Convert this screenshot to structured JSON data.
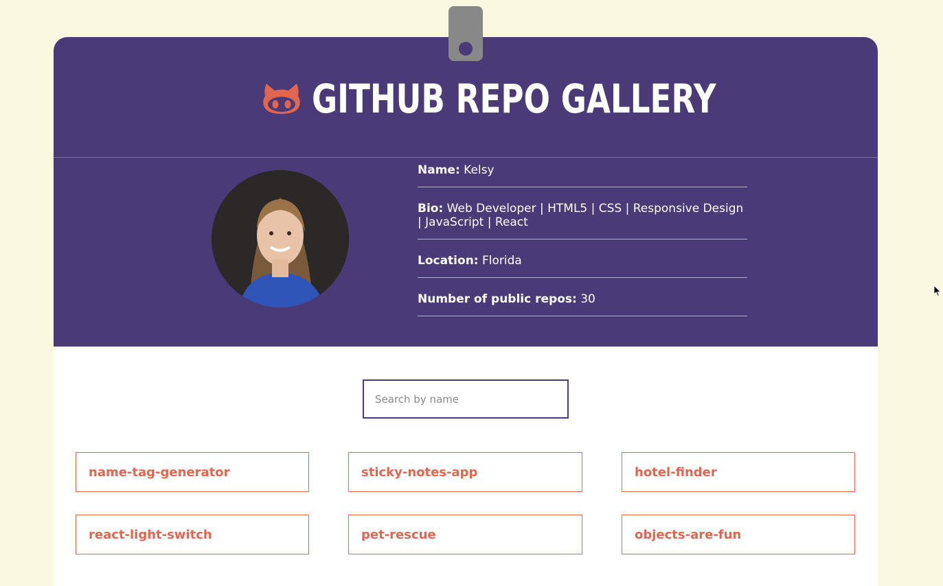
{
  "header": {
    "title": "GITHUB REPO GALLERY",
    "icon": "octocat-icon"
  },
  "profile": {
    "avatar_alt": "avatar",
    "name_label": "Name:",
    "name_value": "Kelsy",
    "bio_label": "Bio:",
    "bio_value": "Web Developer | HTML5 | CSS | Responsive Design | JavaScript | React",
    "location_label": "Location:",
    "location_value": "Florida",
    "repos_label": "Number of public repos:",
    "repos_value": "30"
  },
  "search": {
    "placeholder": "Search by name"
  },
  "repos": [
    "name-tag-generator",
    "sticky-notes-app",
    "hotel-finder",
    "react-light-switch",
    "pet-rescue",
    "objects-are-fun"
  ],
  "colors": {
    "page_background": "#faf8e0",
    "header_background": "#4a3a78",
    "accent": "#e06650",
    "clip": "#888888"
  }
}
